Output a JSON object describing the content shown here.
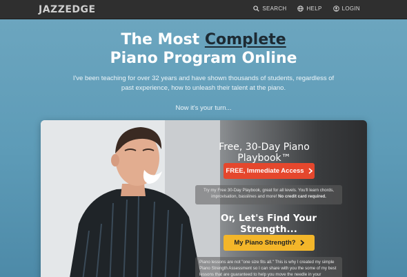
{
  "header": {
    "logo": "JAZZEDGE",
    "nav": [
      {
        "label": "SEARCH",
        "icon": "search-icon"
      },
      {
        "label": "HELP",
        "icon": "globe-icon"
      },
      {
        "label": "LOGIN",
        "icon": "user-circle-icon"
      }
    ]
  },
  "hero": {
    "title_line1_prefix": "The Most ",
    "title_line1_emph": "Complete",
    "title_line2": "Piano Program Online",
    "subtitle": "I've been teaching for over 32 years and have shown thousands of students, regardless of past experience, how to unleash their talent at the piano.",
    "turn": "Now it's your turn..."
  },
  "offer": {
    "title": "Free, 30-Day Piano Playbook™",
    "button_label": "FREE, Immediate Access",
    "description": "Try my Free 30-Day Playbook, great for all levels. You'll learn chords, improvisation, basslines and more!",
    "description_bold": "No credit card required."
  },
  "strength": {
    "title": "Or, Let's Find Your Strength...",
    "button_label": "My Piano Strength?",
    "description": "Piano lessons are not \"one size fits all.\" This is why I created my simple Piano Strength Assessment so I can share with you the some of my best lessons that are guaranteed to help you move the needle in your"
  },
  "colors": {
    "topbar": "#2f2f2f",
    "background": "#5d9bb7",
    "accent_red": "#e5472d",
    "accent_yellow": "#f3b62a",
    "emphasis_text": "#1d2a33"
  }
}
